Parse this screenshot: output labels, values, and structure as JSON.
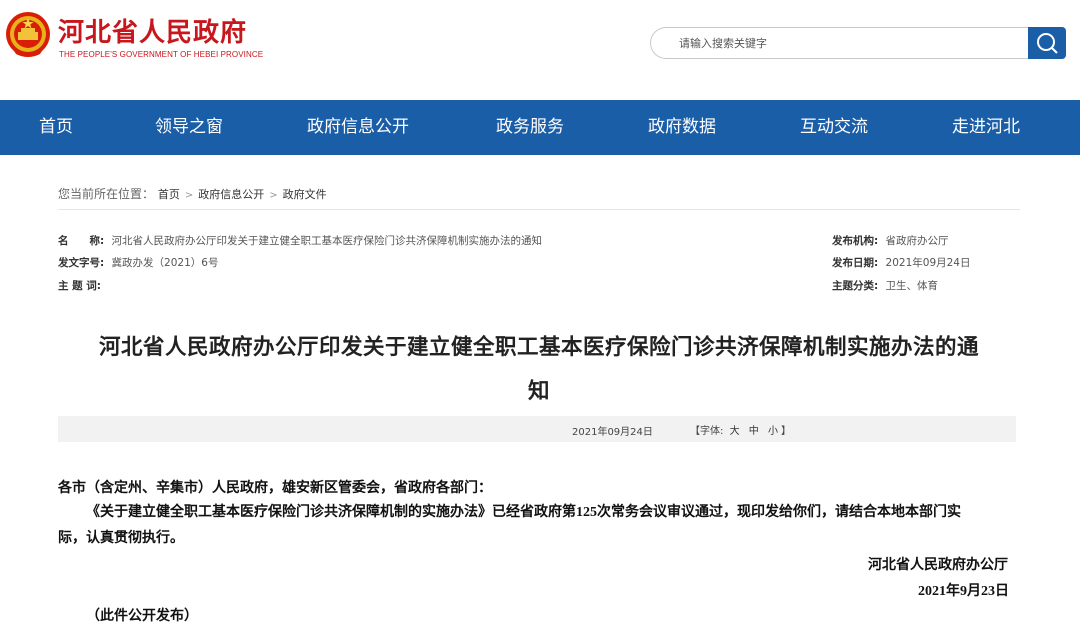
{
  "header": {
    "logo_cn": "河北省人民政府",
    "logo_en": "THE PEOPLE'S GOVERNMENT OF HEBEI PROVINCE",
    "search_placeholder": "请输入搜索关键字"
  },
  "nav": [
    "首页",
    "领导之窗",
    "政府信息公开",
    "政务服务",
    "政府数据",
    "互动交流",
    "走进河北"
  ],
  "breadcrumb": {
    "prefix": "您当前所在位置：",
    "items": [
      "首页",
      "政府信息公开",
      "政府文件"
    ]
  },
  "meta": {
    "name_label": "名　　称:",
    "name_value": "河北省人民政府办公厅印发关于建立健全职工基本医疗保险门诊共济保障机制实施办法的通知",
    "doc_no_label": "发文字号:",
    "doc_no_value": "冀政办发（2021）6号",
    "subject_label": "主 题 词:",
    "subject_value": "",
    "issuer_label": "发布机构:",
    "issuer_value": "省政府办公厅",
    "date_label": "发布日期:",
    "date_value": "2021年09月24日",
    "category_label": "主题分类:",
    "category_value": "卫生、体育"
  },
  "article": {
    "title_line1": "河北省人民政府办公厅印发关于建立健全职工基本医疗保险门诊共济保障机制实施办法的通",
    "title_line2": "知",
    "date": "2021年09月24日",
    "font_label_open": "【字体:",
    "font_large": "大",
    "font_medium": "中",
    "font_small": "小",
    "font_label_close": "】",
    "salutation": "各市（含定州、辛集市）人民政府，雄安新区管委会，省政府各部门：",
    "para1_line1": "《关于建立健全职工基本医疗保险门诊共济保障机制的实施办法》已经省政府第125次常务会议审议通过，现印发给你们，请结合本地本部门实",
    "para1_line2": "际，认真贯彻执行。",
    "signature": "河北省人民政府办公厅",
    "sign_date": "2021年9月23日",
    "note": "（此件公开发布）"
  },
  "colors": {
    "brand_red": "#c8161d",
    "nav_blue": "#1a5ea8"
  }
}
